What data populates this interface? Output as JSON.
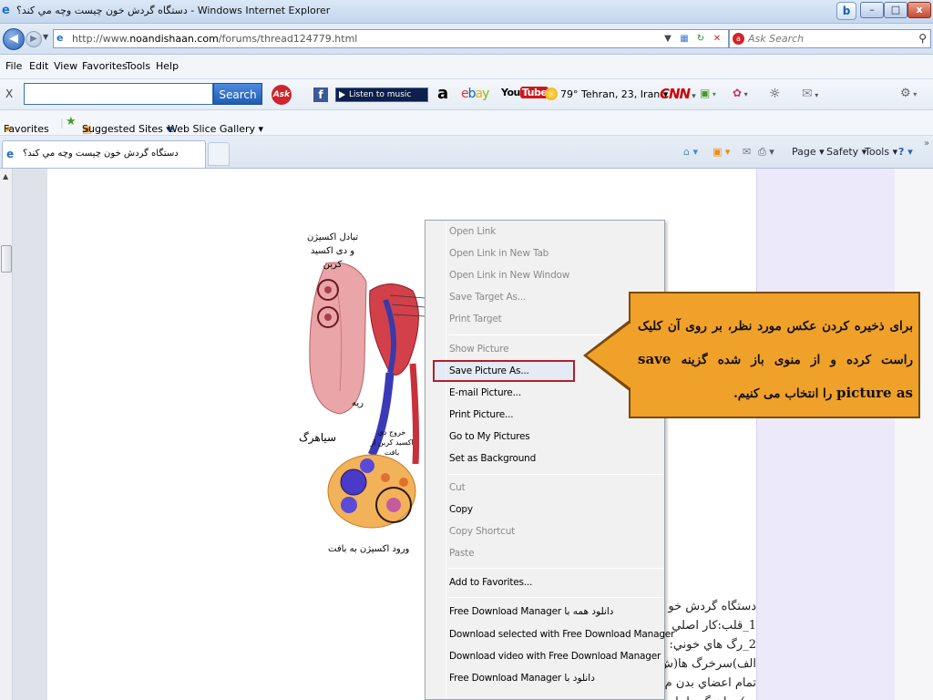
{
  "window": {
    "title": "دستگاه گردش خون چیست وچه مي كند؟ - Windows Internet Explorer",
    "minimize": "–",
    "maximize": "□",
    "close": "x",
    "badge": "b"
  },
  "address_bar": {
    "url_prefix": "http://www.",
    "url_domain": "noandishaan.com",
    "url_path": "/forums/thread124779.html",
    "search_placeholder": "Ask Search"
  },
  "menu": {
    "items": [
      "File",
      "Edit",
      "View",
      "Favorites",
      "Tools",
      "Help"
    ]
  },
  "toolbar": {
    "search_button": "Search",
    "ask_label": "Ask",
    "music_label": "Listen to music",
    "weather": "79° Tehran, 23, Iran ▾",
    "cnn_label": "CNN"
  },
  "favorites_bar": {
    "favorites": "Favorites",
    "suggested": "Suggested Sites ▾",
    "web_slice": "Web Slice Gallery ▾"
  },
  "tab": {
    "title": "دستگاه گردش خون چیست وچه مي كند؟"
  },
  "command_bar": {
    "page": "Page ▾",
    "safety": "Safety ▾",
    "tools": "Tools ▾"
  },
  "diagram": {
    "label_exchange": "تبادل اکسیژن و دی اکسید کربن",
    "label_lung": "ریه",
    "label_vein": "سیاهرگ",
    "label_co2_exit": "خروج دی اکسید کربن از بافت",
    "label_o2_enter": "ورود اکسیژن به بافت"
  },
  "article": {
    "lines": [
      "دستگاه گردش خو",
      "1_قلب:کار اصلي",
      "2_رگ هاي خوني:",
      "الف)سرخرگ ها(ش",
      "تمام اعضاي بدن م",
      "ب)سیاهرگ ها: ا"
    ]
  },
  "context_menu": {
    "items": [
      {
        "label": "Open Link",
        "disabled": true
      },
      {
        "label": "Open Link in New Tab",
        "disabled": true
      },
      {
        "label": "Open Link in New Window",
        "disabled": true
      },
      {
        "label": "Save Target As...",
        "disabled": true
      },
      {
        "label": "Print Target",
        "disabled": true
      },
      {
        "label": "Show Picture",
        "disabled": true
      },
      {
        "label": "Save Picture As...",
        "disabled": false
      },
      {
        "label": "E-mail Picture...",
        "disabled": false
      },
      {
        "label": "Print Picture...",
        "disabled": false
      },
      {
        "label": "Go to My Pictures",
        "disabled": false
      },
      {
        "label": "Set as Background",
        "disabled": false
      },
      {
        "label": "Cut",
        "disabled": true
      },
      {
        "label": "Copy",
        "disabled": false
      },
      {
        "label": "Copy Shortcut",
        "disabled": true
      },
      {
        "label": "Paste",
        "disabled": true
      },
      {
        "label": "Add to Favorites...",
        "disabled": false
      },
      {
        "label": "دانلود همه با Free Download Manager",
        "disabled": false
      },
      {
        "label": "Download selected with Free Download Manager",
        "disabled": false
      },
      {
        "label": "Download video with Free Download Manager",
        "disabled": false
      },
      {
        "label": "دانلود با Free Download Manager",
        "disabled": false
      }
    ]
  },
  "callout": {
    "text_part1": "برای ذخیره کردن عکس مورد نظر، بر روی آن کلیک راست کرده و از منوی باز شده گزینه",
    "keyword": "save picture as",
    "text_part2": "را انتخاب می کنیم."
  },
  "colors": {
    "callout_fill": "#f0a12a",
    "highlight_border": "#b0202c",
    "ie_blue": "#1f6fc0"
  }
}
